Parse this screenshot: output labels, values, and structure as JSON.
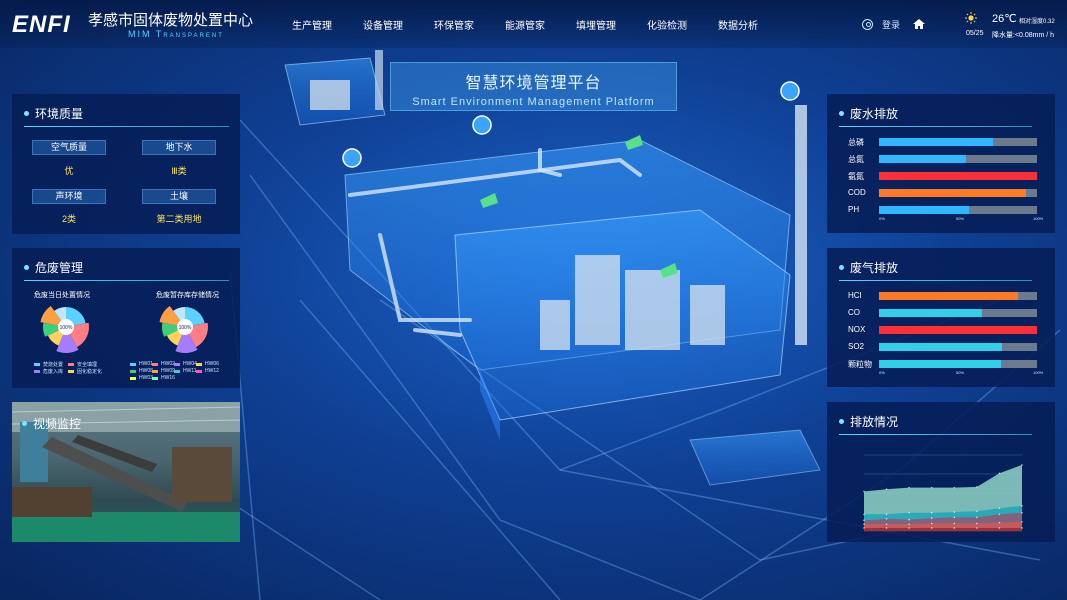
{
  "header": {
    "logo": "ENFI",
    "title": "孝感市固体废物处置中心",
    "subtitle": "MIM Transparent",
    "nav": [
      "生产管理",
      "设备管理",
      "环保管家",
      "能源管家",
      "填埋管理",
      "化验检测",
      "数据分析"
    ],
    "login_label": "登录",
    "weather": {
      "temperature": "26℃",
      "humidity": "相对湿度0.32",
      "date": "05/25",
      "rainfall": "降水量:<0.08mm / h"
    }
  },
  "center_title": {
    "cn": "智慧环境管理平台",
    "en": "Smart Environment Management Platform"
  },
  "env_quality": {
    "title": "环境质量",
    "items": [
      {
        "label": "空气质量",
        "value": "优"
      },
      {
        "label": "地下水",
        "value": "Ⅲ类"
      },
      {
        "label": "声环境",
        "value": "2类"
      },
      {
        "label": "土壤",
        "value": "第二类用地"
      }
    ]
  },
  "hazardous_waste": {
    "title": "危废管理",
    "chart1_title": "危废当日处置情况",
    "chart2_title": "危废暂存库存储情况",
    "center_label": "100%",
    "legend1": [
      {
        "name": "焚烧处置",
        "color": "#5ad1ff"
      },
      {
        "name": "安全填埋",
        "color": "#ff7e86"
      },
      {
        "name": "危废入库",
        "color": "#a67cff"
      },
      {
        "name": "固化稳定化",
        "color": "#ffd25a"
      }
    ],
    "legend2": [
      {
        "name": "HW01",
        "color": "#5ad1ff"
      },
      {
        "name": "HW02",
        "color": "#ff7e86"
      },
      {
        "name": "HW04",
        "color": "#a67cff"
      },
      {
        "name": "HW06",
        "color": "#ffd25a"
      },
      {
        "name": "HW08",
        "color": "#3bd17a"
      },
      {
        "name": "HW09",
        "color": "#ff9f43"
      },
      {
        "name": "HW11",
        "color": "#2fd5c5"
      },
      {
        "name": "HW12",
        "color": "#ff5ab0"
      },
      {
        "name": "HW03",
        "color": "#e9ff5a"
      },
      {
        "name": "HW16",
        "color": "#7cffb5"
      }
    ],
    "pie_colors": [
      "#5ad1ff",
      "#ff7e86",
      "#a67cff",
      "#ffd25a",
      "#3bd17a",
      "#ff9f43",
      "#bde8ff"
    ],
    "pie_values": [
      22,
      20,
      14,
      12,
      10,
      12,
      10
    ]
  },
  "video": {
    "title": "视频监控"
  },
  "wastewater": {
    "title": "废水排放",
    "items": [
      {
        "label": "总磷",
        "value": 72,
        "color": "#2fb8ff"
      },
      {
        "label": "总氮",
        "value": 55,
        "color": "#2fb8ff"
      },
      {
        "label": "氨氮",
        "value": 100,
        "color": "#ff2f35"
      },
      {
        "label": "COD",
        "value": 93,
        "color": "#ff7a22"
      },
      {
        "label": "PH",
        "value": 57,
        "color": "#2fb8ff"
      }
    ],
    "axis": [
      "0%",
      "50%",
      "100%"
    ]
  },
  "waste_gas": {
    "title": "废气排放",
    "items": [
      {
        "label": "HCl",
        "value": 88,
        "color": "#ff7a22"
      },
      {
        "label": "CO",
        "value": 65,
        "color": "#2fd0e8"
      },
      {
        "label": "NOX",
        "value": 100,
        "color": "#ff2f35"
      },
      {
        "label": "SO2",
        "value": 78,
        "color": "#2fd0e8"
      },
      {
        "label": "颗粒物",
        "value": 77,
        "color": "#2fd0e8"
      }
    ],
    "axis": [
      "0%",
      "50%",
      "100%"
    ]
  },
  "emission": {
    "title": "排放情况"
  },
  "chart_data": {
    "type": "area",
    "x": [
      1,
      2,
      3,
      4,
      5,
      6,
      7,
      8
    ],
    "ylim": [
      0,
      100
    ],
    "series": [
      {
        "values": [
          52,
          55,
          57,
          57,
          57,
          58,
          76,
          87
        ],
        "color": "#8fd5c6"
      },
      {
        "values": [
          22,
          22,
          24,
          24,
          25,
          26,
          30,
          33
        ],
        "color": "#1fa9b8"
      },
      {
        "values": [
          14,
          16,
          15,
          17,
          18,
          18,
          22,
          24
        ],
        "color": "#8e5a78"
      },
      {
        "values": [
          9,
          9,
          9,
          10,
          10,
          10,
          11,
          12
        ],
        "color": "#c95b5b"
      },
      {
        "values": [
          4,
          4,
          4,
          4,
          4,
          4,
          4,
          4
        ],
        "color": "#a8272e"
      }
    ]
  },
  "colors": {
    "accent": "#58d6ff",
    "panel_bg": "#061e56",
    "highlight_value": "#ffe35a"
  }
}
